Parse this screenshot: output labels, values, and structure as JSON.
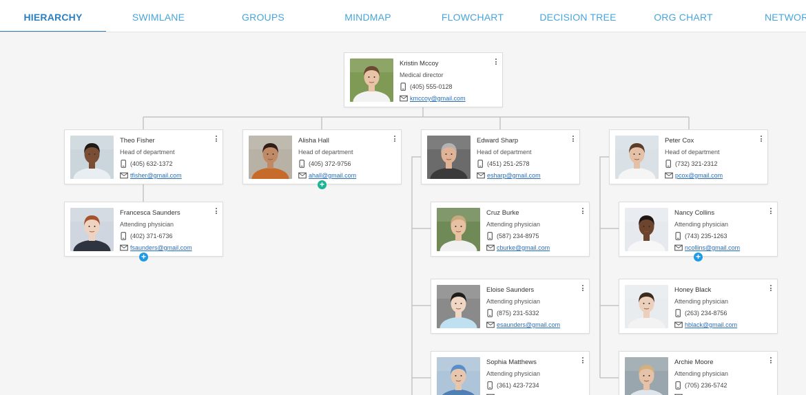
{
  "tabs": [
    {
      "label": "HIERARCHY",
      "active": true
    },
    {
      "label": "SWIMLANE",
      "active": false
    },
    {
      "label": "GROUPS",
      "active": false
    },
    {
      "label": "MINDMAP",
      "active": false
    },
    {
      "label": "FLOWCHART",
      "active": false
    },
    {
      "label": "DECISION TREE",
      "active": false
    },
    {
      "label": "ORG CHART",
      "active": false
    },
    {
      "label": "NETWORK",
      "active": false
    }
  ],
  "colors": {
    "accent": "#2c7fc0",
    "tab": "#47a5dc",
    "connector": "#c4c4c4",
    "add_blue": "#1e9be6",
    "add_teal": "#1bb595",
    "email": "#2b6eb8"
  },
  "cards": [
    {
      "id": "kristin",
      "name": "Kristin Mccoy",
      "title": "Medical director",
      "phone": "(405) 555-0128",
      "email": "kmccoy@gmail.com",
      "add_button": false
    },
    {
      "id": "theo",
      "name": "Theo Fisher",
      "title": "Head of department",
      "phone": "(405) 632-1372",
      "email": "tfisher@gmail.com",
      "add_button": false
    },
    {
      "id": "alisha",
      "name": "Alisha Hall",
      "title": "Head of department",
      "phone": "(405) 372-9756",
      "email": "ahall@gmail.com",
      "add_button": true,
      "add_color": "teal"
    },
    {
      "id": "edward",
      "name": "Edward Sharp",
      "title": "Head of department",
      "phone": "(451) 251-2578",
      "email": "esharp@gmail.com",
      "add_button": false
    },
    {
      "id": "peter",
      "name": "Peter Cox",
      "title": "Head of department",
      "phone": "(732) 321-2312",
      "email": "pcox@gmail.com",
      "add_button": false
    },
    {
      "id": "francesca",
      "name": "Francesca Saunders",
      "title": "Attending physician",
      "phone": "(402) 371-6736",
      "email": "fsaunders@gmail.com",
      "add_button": true,
      "add_color": "blue"
    },
    {
      "id": "cruz",
      "name": "Cruz Burke",
      "title": "Attending physician",
      "phone": "(587) 234-8975",
      "email": "cburke@gmail.com",
      "add_button": false
    },
    {
      "id": "nancy",
      "name": "Nancy Collins",
      "title": "Attending physician",
      "phone": "(743) 235-1263",
      "email": "ncollins@gmail.com",
      "add_button": true,
      "add_color": "blue"
    },
    {
      "id": "eloise",
      "name": "Eloise Saunders",
      "title": "Attending physician",
      "phone": "(875) 231-5332",
      "email": "esaunders@gmail.com",
      "add_button": false
    },
    {
      "id": "honey",
      "name": "Honey Black",
      "title": "Attending physician",
      "phone": "(263) 234-8756",
      "email": "hblack@gmail.com",
      "add_button": false
    },
    {
      "id": "sophia",
      "name": "Sophia Matthews",
      "title": "Attending physician",
      "phone": "(361) 423-7234",
      "email": "",
      "add_button": false
    },
    {
      "id": "archie",
      "name": "Archie Moore",
      "title": "Attending physician",
      "phone": "(705) 236-5742",
      "email": "",
      "add_button": false
    }
  ],
  "icons": {
    "phone": "phone-icon",
    "email": "email-icon",
    "menu": "more-vertical-icon",
    "add": "plus-circle-icon"
  }
}
